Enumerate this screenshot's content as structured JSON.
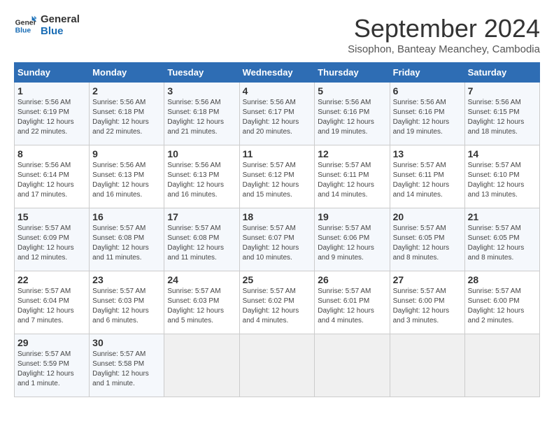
{
  "logo": {
    "line1": "General",
    "line2": "Blue"
  },
  "title": "September 2024",
  "subtitle": "Sisophon, Banteay Meanchey, Cambodia",
  "days_of_week": [
    "Sunday",
    "Monday",
    "Tuesday",
    "Wednesday",
    "Thursday",
    "Friday",
    "Saturday"
  ],
  "weeks": [
    [
      {
        "day": "1",
        "detail": "Sunrise: 5:56 AM\nSunset: 6:19 PM\nDaylight: 12 hours\nand 22 minutes."
      },
      {
        "day": "2",
        "detail": "Sunrise: 5:56 AM\nSunset: 6:18 PM\nDaylight: 12 hours\nand 22 minutes."
      },
      {
        "day": "3",
        "detail": "Sunrise: 5:56 AM\nSunset: 6:18 PM\nDaylight: 12 hours\nand 21 minutes."
      },
      {
        "day": "4",
        "detail": "Sunrise: 5:56 AM\nSunset: 6:17 PM\nDaylight: 12 hours\nand 20 minutes."
      },
      {
        "day": "5",
        "detail": "Sunrise: 5:56 AM\nSunset: 6:16 PM\nDaylight: 12 hours\nand 19 minutes."
      },
      {
        "day": "6",
        "detail": "Sunrise: 5:56 AM\nSunset: 6:16 PM\nDaylight: 12 hours\nand 19 minutes."
      },
      {
        "day": "7",
        "detail": "Sunrise: 5:56 AM\nSunset: 6:15 PM\nDaylight: 12 hours\nand 18 minutes."
      }
    ],
    [
      {
        "day": "8",
        "detail": "Sunrise: 5:56 AM\nSunset: 6:14 PM\nDaylight: 12 hours\nand 17 minutes."
      },
      {
        "day": "9",
        "detail": "Sunrise: 5:56 AM\nSunset: 6:13 PM\nDaylight: 12 hours\nand 16 minutes."
      },
      {
        "day": "10",
        "detail": "Sunrise: 5:56 AM\nSunset: 6:13 PM\nDaylight: 12 hours\nand 16 minutes."
      },
      {
        "day": "11",
        "detail": "Sunrise: 5:57 AM\nSunset: 6:12 PM\nDaylight: 12 hours\nand 15 minutes."
      },
      {
        "day": "12",
        "detail": "Sunrise: 5:57 AM\nSunset: 6:11 PM\nDaylight: 12 hours\nand 14 minutes."
      },
      {
        "day": "13",
        "detail": "Sunrise: 5:57 AM\nSunset: 6:11 PM\nDaylight: 12 hours\nand 14 minutes."
      },
      {
        "day": "14",
        "detail": "Sunrise: 5:57 AM\nSunset: 6:10 PM\nDaylight: 12 hours\nand 13 minutes."
      }
    ],
    [
      {
        "day": "15",
        "detail": "Sunrise: 5:57 AM\nSunset: 6:09 PM\nDaylight: 12 hours\nand 12 minutes."
      },
      {
        "day": "16",
        "detail": "Sunrise: 5:57 AM\nSunset: 6:08 PM\nDaylight: 12 hours\nand 11 minutes."
      },
      {
        "day": "17",
        "detail": "Sunrise: 5:57 AM\nSunset: 6:08 PM\nDaylight: 12 hours\nand 11 minutes."
      },
      {
        "day": "18",
        "detail": "Sunrise: 5:57 AM\nSunset: 6:07 PM\nDaylight: 12 hours\nand 10 minutes."
      },
      {
        "day": "19",
        "detail": "Sunrise: 5:57 AM\nSunset: 6:06 PM\nDaylight: 12 hours\nand 9 minutes."
      },
      {
        "day": "20",
        "detail": "Sunrise: 5:57 AM\nSunset: 6:05 PM\nDaylight: 12 hours\nand 8 minutes."
      },
      {
        "day": "21",
        "detail": "Sunrise: 5:57 AM\nSunset: 6:05 PM\nDaylight: 12 hours\nand 8 minutes."
      }
    ],
    [
      {
        "day": "22",
        "detail": "Sunrise: 5:57 AM\nSunset: 6:04 PM\nDaylight: 12 hours\nand 7 minutes."
      },
      {
        "day": "23",
        "detail": "Sunrise: 5:57 AM\nSunset: 6:03 PM\nDaylight: 12 hours\nand 6 minutes."
      },
      {
        "day": "24",
        "detail": "Sunrise: 5:57 AM\nSunset: 6:03 PM\nDaylight: 12 hours\nand 5 minutes."
      },
      {
        "day": "25",
        "detail": "Sunrise: 5:57 AM\nSunset: 6:02 PM\nDaylight: 12 hours\nand 4 minutes."
      },
      {
        "day": "26",
        "detail": "Sunrise: 5:57 AM\nSunset: 6:01 PM\nDaylight: 12 hours\nand 4 minutes."
      },
      {
        "day": "27",
        "detail": "Sunrise: 5:57 AM\nSunset: 6:00 PM\nDaylight: 12 hours\nand 3 minutes."
      },
      {
        "day": "28",
        "detail": "Sunrise: 5:57 AM\nSunset: 6:00 PM\nDaylight: 12 hours\nand 2 minutes."
      }
    ],
    [
      {
        "day": "29",
        "detail": "Sunrise: 5:57 AM\nSunset: 5:59 PM\nDaylight: 12 hours\nand 1 minute."
      },
      {
        "day": "30",
        "detail": "Sunrise: 5:57 AM\nSunset: 5:58 PM\nDaylight: 12 hours\nand 1 minute."
      },
      {
        "day": "",
        "detail": ""
      },
      {
        "day": "",
        "detail": ""
      },
      {
        "day": "",
        "detail": ""
      },
      {
        "day": "",
        "detail": ""
      },
      {
        "day": "",
        "detail": ""
      }
    ]
  ]
}
